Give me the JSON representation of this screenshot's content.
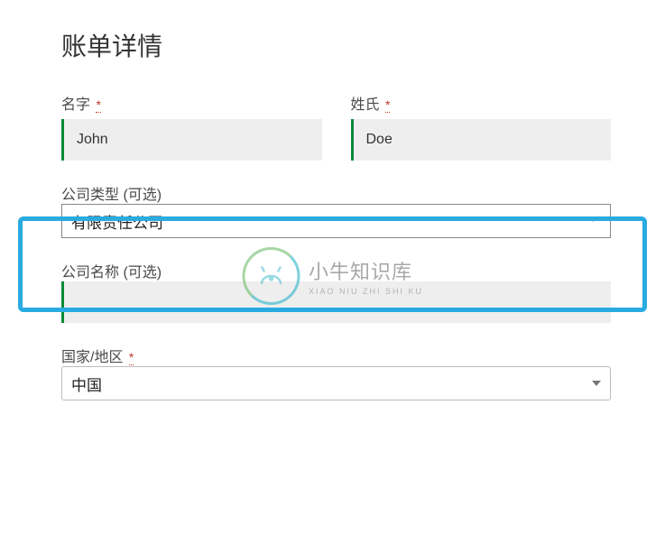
{
  "heading": "账单详情",
  "fields": {
    "first_name": {
      "label": "名字",
      "value": "John",
      "required": true
    },
    "last_name": {
      "label": "姓氏",
      "value": "Doe",
      "required": true
    },
    "company_type": {
      "label": "公司类型 (可选)",
      "value": "有限责任公司"
    },
    "company_name": {
      "label": "公司名称 (可选)",
      "value": ""
    },
    "country": {
      "label": "国家/地区",
      "value": "中国",
      "required": true
    }
  },
  "required_marker": "*",
  "watermark": {
    "title": "小牛知识库",
    "subtitle": "XIAO NIU ZHI SHI KU"
  }
}
